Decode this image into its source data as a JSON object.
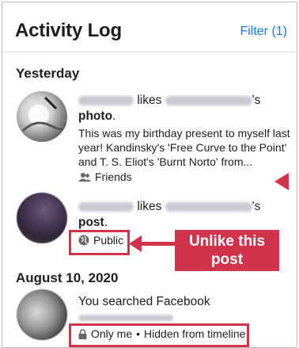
{
  "header": {
    "title": "Activity Log",
    "filter_label": "Filter (1)"
  },
  "sections": [
    {
      "label": "Yesterday"
    },
    {
      "label": "August 10, 2020"
    }
  ],
  "entries": [
    {
      "verb": "likes",
      "possessive": "'s",
      "object": "photo",
      "period": ".",
      "excerpt": "This was my birthday present to myself last year! Kandinsky's 'Free Curve to the Point' and T. S. Eliot's 'Burnt Norto' from...",
      "audience": "Friends",
      "audience_icon": "friends-icon"
    },
    {
      "verb": "likes",
      "possessive": "'s",
      "object": "post",
      "period": ".",
      "audience": "Public",
      "audience_icon": "globe-icon"
    },
    {
      "action": "You searched Facebook",
      "audience": "Only me",
      "audience_icon": "lock-icon",
      "separator": "•",
      "visibility": "Hidden from timeline"
    }
  ],
  "callout": {
    "line1": "Unlike this",
    "line2": "post"
  },
  "colors": {
    "accent": "#1877f2",
    "annotation": "#d0334a"
  }
}
